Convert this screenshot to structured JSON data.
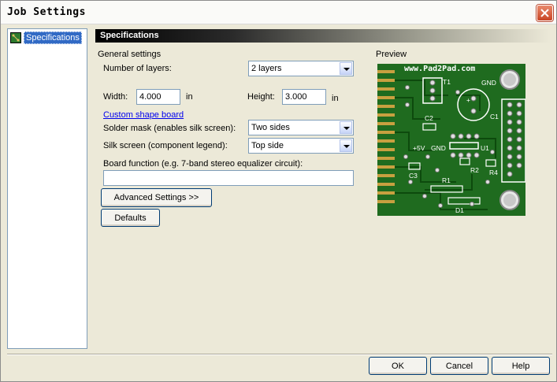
{
  "window": {
    "title": "Job Settings"
  },
  "sidebar": {
    "items": [
      {
        "label": "Specifications"
      }
    ]
  },
  "section": {
    "title": "Specifications"
  },
  "general": {
    "heading": "General settings",
    "layers_label": "Number of layers:",
    "layers_value": "2 layers",
    "width_label": "Width:",
    "width_value": "4.000",
    "width_unit": "in",
    "height_label": "Height:",
    "height_value": "3.000",
    "height_unit": "in",
    "custom_shape_link": "Custom shape board",
    "solder_mask_label": "Solder mask (enables silk screen):",
    "solder_mask_value": "Two sides",
    "silk_screen_label": "Silk screen (component legend):",
    "silk_screen_value": "Top side",
    "board_function_label": "Board function (e.g. 7-band stereo equalizer circuit):",
    "board_function_value": ""
  },
  "buttons": {
    "advanced": "Advanced Settings >>",
    "defaults": "Defaults",
    "ok": "OK",
    "cancel": "Cancel",
    "help": "Help"
  },
  "preview": {
    "heading": "Preview",
    "url": "www.Pad2Pad.com",
    "labels": {
      "t1": "T1",
      "gnd_top": "GND",
      "c1": "C1",
      "c2": "C2",
      "plus5v": "+5V",
      "gnd": "GND",
      "u1": "U1",
      "c3": "C3",
      "r2": "R2",
      "r4": "R4",
      "r1": "R1",
      "d1": "D1",
      "plus": "+"
    }
  },
  "colors": {
    "board": "#1f6b1f",
    "pad": "#c8a040",
    "trace": "#0d4a0d",
    "accent": "#316ac5"
  }
}
